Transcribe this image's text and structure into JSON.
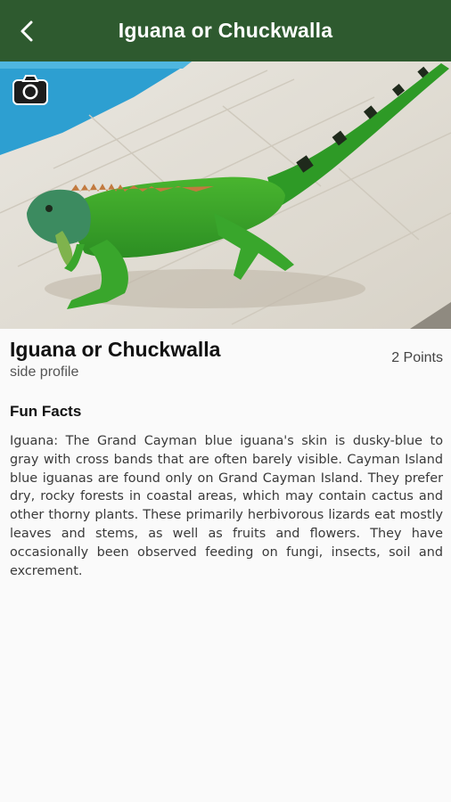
{
  "appbar": {
    "title": "Iguana or Chuckwalla",
    "back_icon": "arrow-back-icon",
    "color": "#2e5a2f"
  },
  "hero": {
    "camera_icon": "camera-icon"
  },
  "species": {
    "name": "Iguana or Chuckwalla",
    "subtitle": "side profile",
    "points": "2 Points"
  },
  "fun_facts": {
    "heading": "Fun Facts",
    "text": "Iguana: The Grand Cayman blue iguana's skin is dusky-blue to gray with cross bands that are often barely visible. Cayman Island blue iguanas are found only on Grand Cayman Island. They prefer dry, rocky forests in coastal areas, which may contain cactus and other thorny plants. These primarily herbivorous lizards eat mostly leaves and stems, as well as fruits and flowers. They have occasionally been observed feeding on fungi, insects, soil and excrement."
  }
}
